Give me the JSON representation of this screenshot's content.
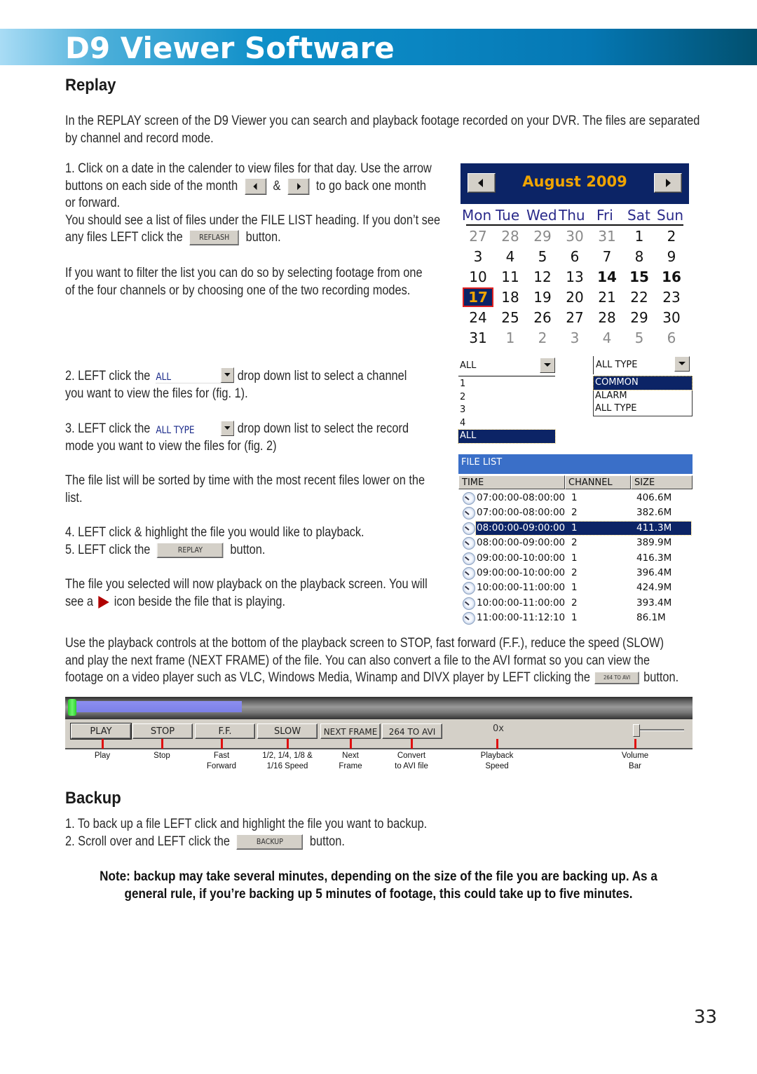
{
  "banner": {
    "title": "D9 Viewer Software"
  },
  "replay": {
    "heading": "Replay",
    "intro": [
      "In the REPLAY screen of the D9 Viewer you can search and playback footage recorded on your DVR. The files are separated",
      "by channel and record mode."
    ],
    "step1": {
      "line1": "1. Click on a date in the calender to view files for that day. Use the arrow",
      "line2a": "buttons on each side of the month",
      "amp": "&",
      "line2b": "to go back one month",
      "line3": "or forward.",
      "line4": "You should see a list of files under the FILE LIST heading. If you don’t see",
      "line5a": "any files LEFT click the",
      "reflash_label": "REFLASH",
      "line5b": "button."
    },
    "filter": [
      "If you want to filter the list you can do so by selecting footage from one",
      "of the four channels or by choosing one of the two recording modes."
    ],
    "step2": {
      "a": "2. LEFT click the",
      "dd": "ALL",
      "b": "drop down list to select a channel",
      "c": "you want to view the files for (fig. 1)."
    },
    "step3": {
      "a": "3. LEFT click the",
      "dd": "ALL TYPE",
      "b": "drop down list to select the record",
      "c": "mode you want to view the files for (fig. 2)"
    },
    "sorted": [
      "The file list will be sorted by time with the most recent files lower on the",
      "list."
    ],
    "step4": "4. LEFT click & highlight the file you would like to playback.",
    "step5": {
      "a": "5. LEFT click the",
      "btn": "REPLAY",
      "b": "button."
    },
    "playing": {
      "line1": "The file you selected will now playback on the playback screen. You will",
      "a": "see a",
      "b": "icon beside the file that is playing."
    },
    "controls_text": {
      "line1": "Use the playback controls at the bottom of the playback screen to STOP, fast forward (F.F.), reduce the speed (SLOW)",
      "line2": "and play the next frame (NEXT FRAME) of the file. You can also convert a file to the AVI format so you can view the",
      "line3a": "footage on a video player such as VLC, Windows Media, Winamp and DIVX player by LEFT clicking the",
      "btn": "264 TO AVI",
      "line3b": "button."
    }
  },
  "calendar": {
    "month_label": "August 2009",
    "prev_icon": "left-arrow-icon",
    "next_icon": "right-arrow-icon",
    "weekdays": [
      "Mon",
      "Tue",
      "Wed",
      "Thu",
      "Fri",
      "Sat",
      "Sun"
    ],
    "weeks": [
      [
        "27",
        "28",
        "29",
        "30",
        "31",
        "1",
        "2"
      ],
      [
        "3",
        "4",
        "5",
        "6",
        "7",
        "8",
        "9"
      ],
      [
        "10",
        "11",
        "12",
        "13",
        "14",
        "15",
        "16"
      ],
      [
        "17",
        "18",
        "19",
        "20",
        "21",
        "22",
        "23"
      ],
      [
        "24",
        "25",
        "26",
        "27",
        "28",
        "29",
        "30"
      ],
      [
        "31",
        "1",
        "2",
        "3",
        "4",
        "5",
        "6"
      ]
    ],
    "selected_day": "17",
    "bold_days": [
      "14",
      "15",
      "16"
    ],
    "colors": {
      "header_bg": "#0c2466",
      "month_text": "#f0a400",
      "selected_outline": "#e02020"
    }
  },
  "channel_dropdown": {
    "value": "ALL",
    "options": [
      "1",
      "2",
      "3",
      "4",
      "ALL"
    ],
    "highlighted": "ALL"
  },
  "type_dropdown": {
    "value": "ALL TYPE",
    "options": [
      "COMMON",
      "ALARM",
      "ALL TYPE"
    ],
    "highlighted": "COMMON"
  },
  "file_list": {
    "title": "FILE LIST",
    "columns": [
      "TIME",
      "CHANNEL",
      "SIZE"
    ],
    "rows": [
      {
        "time": "07:00:00-08:00:00",
        "channel": "1",
        "size": "406.6M"
      },
      {
        "time": "07:00:00-08:00:00",
        "channel": "2",
        "size": "382.6M"
      },
      {
        "time": "08:00:00-09:00:00",
        "channel": "1",
        "size": "411.3M",
        "selected": true
      },
      {
        "time": "08:00:00-09:00:00",
        "channel": "2",
        "size": "389.9M"
      },
      {
        "time": "09:00:00-10:00:00",
        "channel": "1",
        "size": "416.3M"
      },
      {
        "time": "09:00:00-10:00:00",
        "channel": "2",
        "size": "396.4M"
      },
      {
        "time": "10:00:00-11:00:00",
        "channel": "1",
        "size": "424.9M"
      },
      {
        "time": "10:00:00-11:00:00",
        "channel": "2",
        "size": "393.4M"
      },
      {
        "time": "11:00:00-11:12:10",
        "channel": "1",
        "size": "86.1M"
      }
    ]
  },
  "playback": {
    "progress_fraction": 0.27,
    "buttons": [
      "PLAY",
      "STOP",
      "F.F.",
      "SLOW",
      "NEXT FRAME",
      "264 TO AVI"
    ],
    "speed": "0x",
    "volume_fraction": 0.0,
    "captions": [
      [
        "Play",
        ""
      ],
      [
        "Stop",
        ""
      ],
      [
        "Fast",
        "Forward"
      ],
      [
        "1/2, 1/4, 1/8 &",
        "1/16 Speed"
      ],
      [
        "Next",
        "Frame"
      ],
      [
        "Convert",
        "to AVI file"
      ],
      [
        "Playback",
        "Speed"
      ],
      [
        "Volume",
        "Bar"
      ]
    ]
  },
  "backup": {
    "heading": "Backup",
    "step1": "1. To back up a file LEFT click and highlight the file you want to backup.",
    "step2a": "2. Scroll over and LEFT click the",
    "btn": "BACKUP",
    "step2b": "button.",
    "note": [
      "Note: backup may take several minutes, depending on the size of the file you are backing up. As a",
      "general rule, if you’re backing up 5 minutes of footage, this could take up to five minutes."
    ]
  },
  "page_number": "33"
}
